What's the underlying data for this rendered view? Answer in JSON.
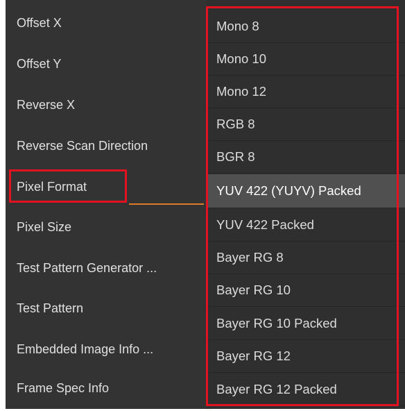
{
  "properties": [
    {
      "label": "Offset X"
    },
    {
      "label": "Offset Y"
    },
    {
      "label": "Reverse X"
    },
    {
      "label": "Reverse Scan Direction"
    },
    {
      "label": "Pixel Format"
    },
    {
      "label": "Pixel Size"
    },
    {
      "label": "Test Pattern Generator ..."
    },
    {
      "label": "Test Pattern"
    },
    {
      "label": "Embedded Image Info ..."
    },
    {
      "label": "Frame Spec Info"
    }
  ],
  "dropdown": {
    "selected": "YUV 422 (YUYV) Packed",
    "options": [
      {
        "label": "Mono 8"
      },
      {
        "label": "Mono 10"
      },
      {
        "label": "Mono 12"
      },
      {
        "label": "RGB 8"
      },
      {
        "label": "BGR 8"
      },
      {
        "label": "YUV 422 (YUYV) Packed"
      },
      {
        "label": "YUV 422 Packed"
      },
      {
        "label": "Bayer RG 8"
      },
      {
        "label": "Bayer RG 10"
      },
      {
        "label": "Bayer RG 10 Packed"
      },
      {
        "label": "Bayer RG 12"
      },
      {
        "label": "Bayer RG 12 Packed"
      }
    ]
  },
  "colors": {
    "panel_bg": "#333333",
    "highlight_box": "#e3121f",
    "active_underline": "#e07b2a",
    "selected_bg": "#505050"
  }
}
